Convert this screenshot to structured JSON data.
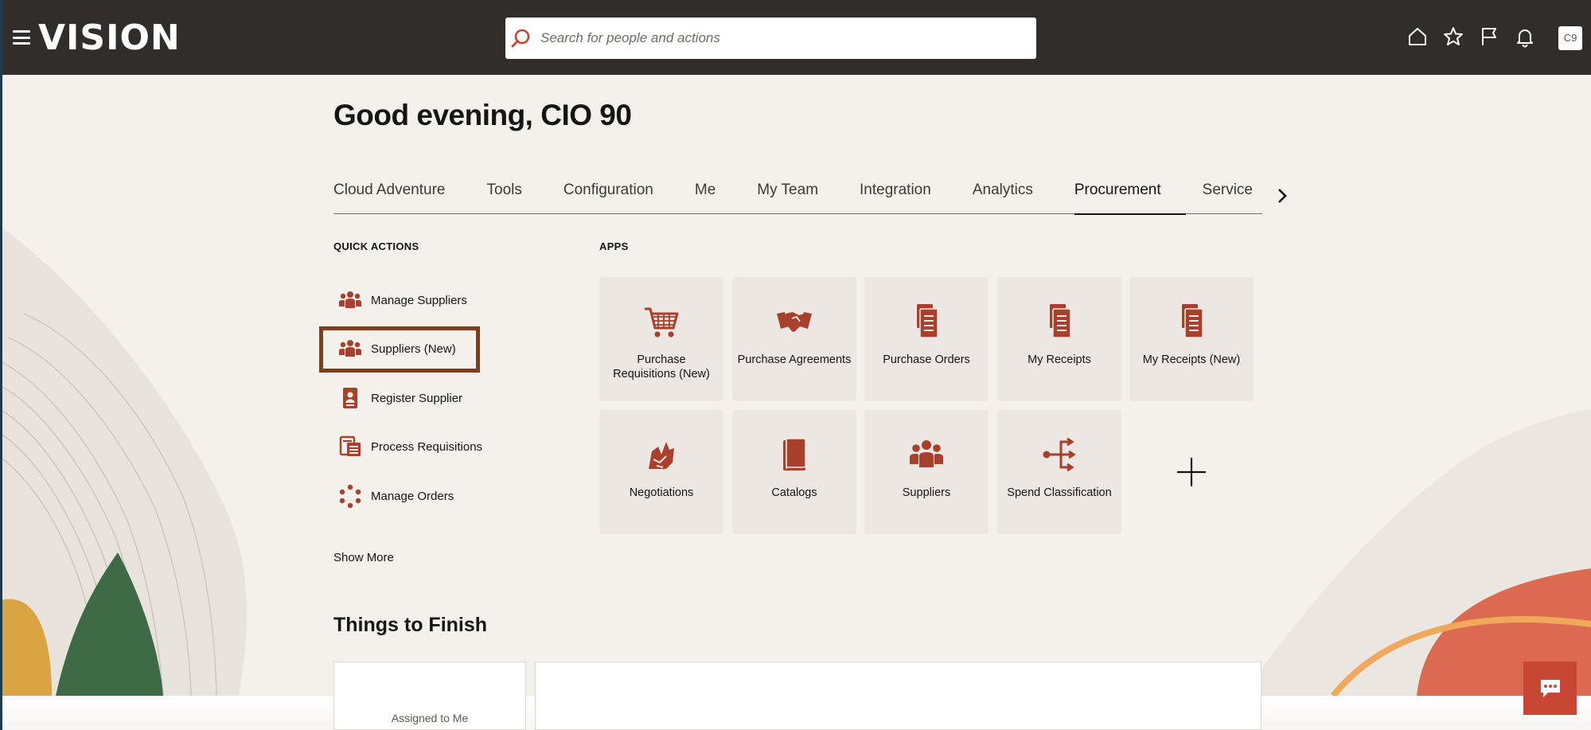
{
  "header": {
    "logo_text": "VISION",
    "search_placeholder": "Search for people and actions",
    "avatar_initials": "C9",
    "icons": [
      "menu-icon",
      "search-icon",
      "home-icon",
      "favorites-star-icon",
      "flag-icon",
      "notifications-bell-icon"
    ]
  },
  "greeting": "Good evening, CIO 90",
  "tabs": [
    {
      "label": "Cloud Adventure"
    },
    {
      "label": "Tools"
    },
    {
      "label": "Configuration"
    },
    {
      "label": "Me"
    },
    {
      "label": "My Team"
    },
    {
      "label": "Integration"
    },
    {
      "label": "Analytics"
    },
    {
      "label": "Procurement",
      "active": true
    },
    {
      "label": "Service"
    }
  ],
  "quick_actions": {
    "heading": "QUICK ACTIONS",
    "items": [
      {
        "label": "Manage Suppliers",
        "icon": "suppliers-group-icon"
      },
      {
        "label": "Suppliers (New)",
        "icon": "suppliers-group-icon",
        "highlighted": true
      },
      {
        "label": "Register Supplier",
        "icon": "register-badge-icon"
      },
      {
        "label": "Process Requisitions",
        "icon": "process-requisitions-icon"
      },
      {
        "label": "Manage Orders",
        "icon": "manage-orders-cycle-icon"
      }
    ],
    "show_more": "Show More"
  },
  "apps": {
    "heading": "APPS",
    "tiles": [
      {
        "label": "Purchase Requisitions (New)",
        "icon": "shopping-cart-icon"
      },
      {
        "label": "Purchase Agreements",
        "icon": "handshake-icon"
      },
      {
        "label": "Purchase Orders",
        "icon": "document-stack-icon"
      },
      {
        "label": "My Receipts",
        "icon": "document-stack-icon"
      },
      {
        "label": "My Receipts (New)",
        "icon": "document-stack-icon"
      },
      {
        "label": "Negotiations",
        "icon": "negotiations-icon"
      },
      {
        "label": "Catalogs",
        "icon": "catalog-book-icon"
      },
      {
        "label": "Suppliers",
        "icon": "suppliers-group-icon"
      },
      {
        "label": "Spend Classification",
        "icon": "spend-classification-icon"
      }
    ],
    "add_icon": "plus-icon"
  },
  "things_to_finish": {
    "heading": "Things to Finish",
    "assigned_label": "Assigned to Me"
  },
  "colors": {
    "header_bg": "#312d2a",
    "page_bg": "#f4f0ec",
    "accent": "#c74634",
    "icon_color": "#a8402c",
    "highlight_border": "#7b3f1d"
  },
  "chat_icon": "chat-bubble-icon"
}
